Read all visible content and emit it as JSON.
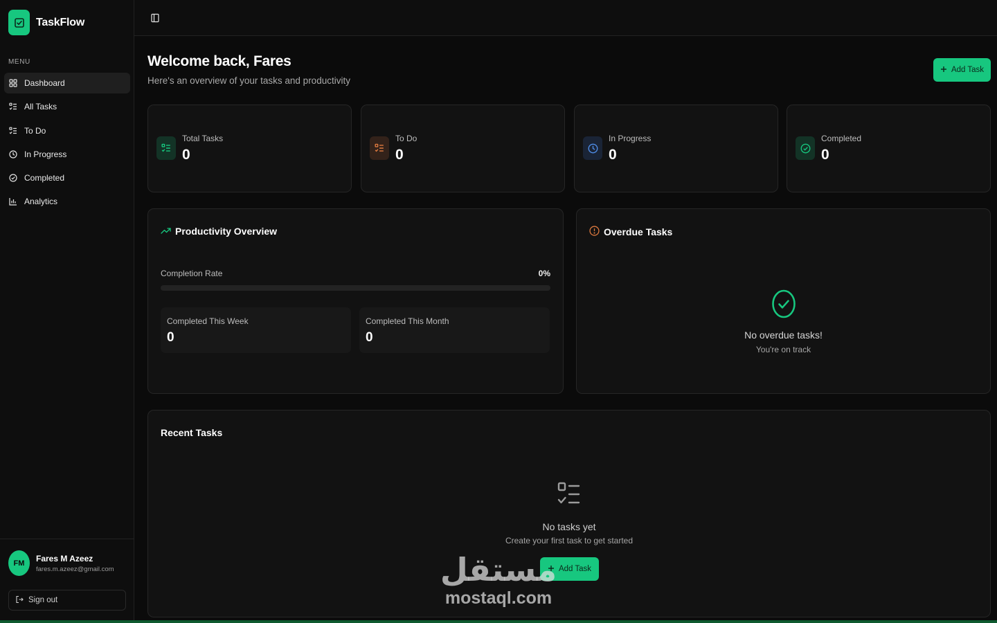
{
  "app": {
    "name": "TaskFlow"
  },
  "colors": {
    "accent": "#17c77f",
    "todo": "#e07a3f",
    "in_progress": "#4f8de8",
    "overdue": "#e07a3f"
  },
  "sidebar": {
    "menu_label": "MENU",
    "items": [
      {
        "label": "Dashboard",
        "icon": "layout-grid-icon",
        "active": true
      },
      {
        "label": "All Tasks",
        "icon": "list-checks-icon",
        "active": false
      },
      {
        "label": "To Do",
        "icon": "list-checks-icon",
        "active": false
      },
      {
        "label": "In Progress",
        "icon": "clock-icon",
        "active": false
      },
      {
        "label": "Completed",
        "icon": "check-circle-icon",
        "active": false
      },
      {
        "label": "Analytics",
        "icon": "bar-chart-icon",
        "active": false
      }
    ],
    "user": {
      "initials": "FM",
      "name": "Fares M Azeez",
      "email": "fares.m.azeez@gmail.com"
    },
    "sign_out": "Sign out"
  },
  "header": {
    "title": "Welcome back, Fares",
    "subtitle": "Here's an overview of your tasks and productivity",
    "add_task": "Add Task"
  },
  "stats": [
    {
      "label": "Total Tasks",
      "value": "0",
      "icon": "list-checks-icon"
    },
    {
      "label": "To Do",
      "value": "0",
      "icon": "list-checks-icon"
    },
    {
      "label": "In Progress",
      "value": "0",
      "icon": "clock-icon"
    },
    {
      "label": "Completed",
      "value": "0",
      "icon": "check-circle-icon"
    }
  ],
  "productivity": {
    "title": "Productivity Overview",
    "completion_label": "Completion Rate",
    "completion_value": "0%",
    "completion_fraction": 0,
    "week_label": "Completed This Week",
    "week_value": "0",
    "month_label": "Completed This Month",
    "month_value": "0"
  },
  "overdue": {
    "title": "Overdue Tasks",
    "empty_title": "No overdue tasks!",
    "empty_sub": "You're on track"
  },
  "recent": {
    "title": "Recent Tasks",
    "empty_title": "No tasks yet",
    "empty_sub": "Create your first task to get started",
    "add_task": "Add Task"
  },
  "watermark": {
    "arabic": "مستقل",
    "latin": "mostaql.com"
  }
}
